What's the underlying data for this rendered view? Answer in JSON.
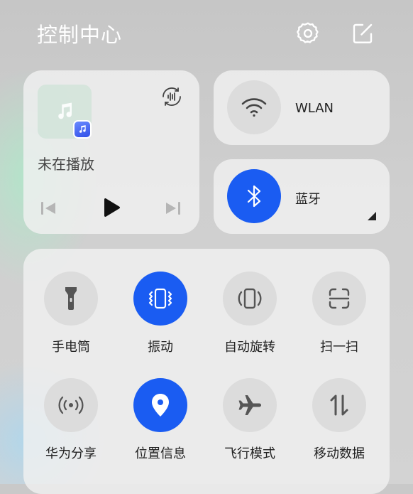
{
  "header": {
    "title": "控制中心",
    "settings_icon": "gear-icon",
    "edit_icon": "edit-icon"
  },
  "media": {
    "status": "未在播放",
    "art_icon": "music-note-icon",
    "app_icon": "music-app-icon",
    "output_icon": "audio-wave-icon",
    "prev_icon": "skip-previous-icon",
    "play_icon": "play-icon",
    "next_icon": "skip-next-icon"
  },
  "wlan": {
    "label": "WLAN",
    "icon": "wifi-icon",
    "active": false
  },
  "bluetooth": {
    "label": "蓝牙",
    "icon": "bluetooth-icon",
    "active": true
  },
  "colors": {
    "accent": "#1a5cf2",
    "tile_off": "#dcdcdc",
    "icon_off": "#555555"
  },
  "toggles": [
    {
      "label": "手电筒",
      "icon": "flashlight-icon",
      "active": false
    },
    {
      "label": "振动",
      "icon": "vibrate-icon",
      "active": true
    },
    {
      "label": "自动旋转",
      "icon": "auto-rotate-icon",
      "active": false
    },
    {
      "label": "扫一扫",
      "icon": "scan-icon",
      "active": false
    },
    {
      "label": "华为分享",
      "icon": "share-icon",
      "active": false
    },
    {
      "label": "位置信息",
      "icon": "location-icon",
      "active": true
    },
    {
      "label": "飞行模式",
      "icon": "airplane-icon",
      "active": false
    },
    {
      "label": "移动数据",
      "icon": "mobile-data-icon",
      "active": false
    }
  ]
}
